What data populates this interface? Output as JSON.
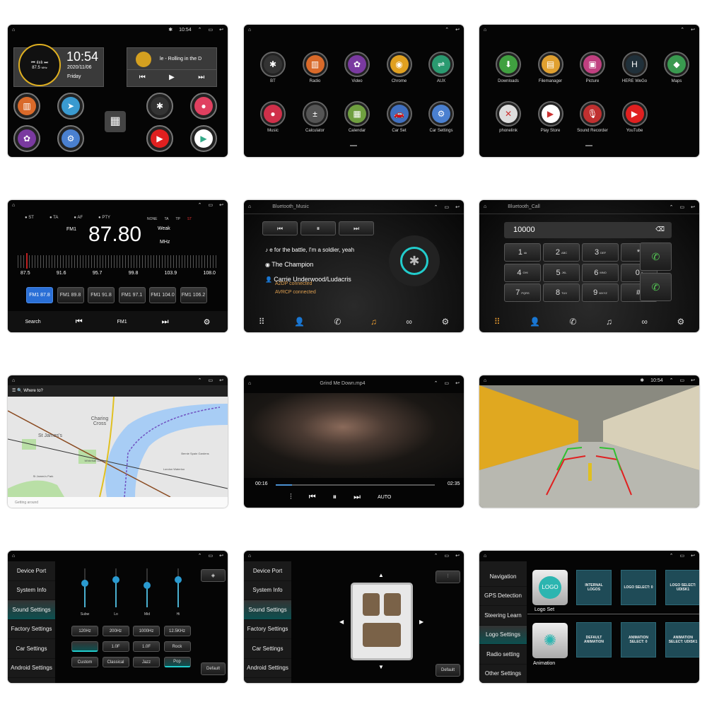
{
  "nav": {
    "home": "⌂",
    "up": "⌃",
    "recent": "▭",
    "back": "↩"
  },
  "home": {
    "time": "10:54",
    "clock": "10:54",
    "date": "2020/11/06",
    "day": "Friday",
    "radio_freq": "87.5",
    "radio_unit": "MHz",
    "song": "le - Rolling in the D"
  },
  "apps_page1": [
    {
      "label": "BT",
      "color": "#333",
      "glyph": "✱"
    },
    {
      "label": "Radio",
      "color": "#d96a2a",
      "glyph": "▥"
    },
    {
      "label": "Video",
      "color": "#7a3aa0",
      "glyph": "✿"
    },
    {
      "label": "Chrome",
      "color": "#e0a020",
      "glyph": "◉"
    },
    {
      "label": "AUX",
      "color": "#2a9a70",
      "glyph": "⇌"
    },
    {
      "label": "Music",
      "color": "#d0304a",
      "glyph": "●"
    },
    {
      "label": "Calculator",
      "color": "#555",
      "glyph": "±"
    },
    {
      "label": "Calendar",
      "color": "#70a040",
      "glyph": "▦"
    },
    {
      "label": "Car Set",
      "color": "#4070c0",
      "glyph": "🚗"
    },
    {
      "label": "Car Settings",
      "color": "#4a80d0",
      "glyph": "⚙"
    }
  ],
  "apps_page2": [
    {
      "label": "Downloads",
      "color": "#40a040",
      "glyph": "⬇"
    },
    {
      "label": "Filemanager",
      "color": "#e0a030",
      "glyph": "▤"
    },
    {
      "label": "Picture",
      "color": "#c04080",
      "glyph": "▣"
    },
    {
      "label": "HERE WeGo",
      "color": "#20303a",
      "glyph": "H"
    },
    {
      "label": "Maps",
      "color": "#3a9a50",
      "glyph": "◆"
    },
    {
      "label": "phonelink",
      "color": "#ddd",
      "glyph": "✕"
    },
    {
      "label": "Play Store",
      "color": "#fff",
      "glyph": "▶"
    },
    {
      "label": "Sound Recorder",
      "color": "#c03030",
      "glyph": "🎙"
    },
    {
      "label": "YouTube",
      "color": "#e02020",
      "glyph": "▶"
    }
  ],
  "radio": {
    "flags": [
      "ST",
      "TA",
      "AF",
      "PTY"
    ],
    "right_flags": [
      "NONE",
      "TA",
      "TP",
      "ST"
    ],
    "band": "FM1",
    "freq": "87.80",
    "signal": "Weak",
    "unit": "MHz",
    "scale": [
      "87.5",
      "91.6",
      "95.7",
      "99.8",
      "103.9",
      "108.0"
    ],
    "presets": [
      "FM1 87.8",
      "FM1 89.8",
      "FM1 91.8",
      "FM1 97.1",
      "FM1 104.0",
      "FM1 106.2"
    ],
    "active_preset": 0,
    "search": "Search",
    "band_btn": "FM1",
    "accent": "#2a6fd6"
  },
  "bt_music": {
    "title": "Bluetooth_Music",
    "lyric": "e for the battle, I'm a soldier, yeah",
    "song": "The Champion",
    "artist": "Carrie Underwood/Ludacris",
    "status1": "A2DP connected",
    "status2": "AVRCP connected"
  },
  "bt_call": {
    "title": "Bluetooth_Call",
    "number": "10000",
    "keys": [
      [
        "1",
        "ꝏ"
      ],
      [
        "2",
        "ABC"
      ],
      [
        "3",
        "DEF"
      ],
      [
        "*",
        ""
      ],
      [
        "4",
        "GHI"
      ],
      [
        "5",
        "JKL"
      ],
      [
        "6",
        "MNO"
      ],
      [
        "0",
        "+"
      ],
      [
        "7",
        "PQRS"
      ],
      [
        "8",
        "TUV"
      ],
      [
        "9",
        "WXYZ"
      ],
      [
        "#",
        ""
      ]
    ]
  },
  "map": {
    "search": "Where to?",
    "places": [
      "Charing Cross",
      "St James's",
      "London Waterloo",
      "Bernie Spain Gardens",
      "Whitehall Gardens",
      "St James's Park"
    ],
    "status": "Getting around"
  },
  "video": {
    "title": "Grind Me Down.mp4",
    "elapsed": "00:16",
    "total": "02:35",
    "mode": "AUTO",
    "progress": 0.1
  },
  "camera": {
    "time": "10:54"
  },
  "sound": {
    "menu": [
      "Device Port",
      "System Info",
      "Sound Settings",
      "Factory Settings",
      "Car Settings",
      "Android Settings"
    ],
    "active": 2,
    "bands": [
      "Subw",
      "Lo",
      "Mid",
      "Hi"
    ],
    "levels": [
      0.6,
      0.7,
      0.55,
      0.7
    ],
    "freqs": [
      "120Hz",
      "200Hz",
      "1000Hz",
      "12.5KHz"
    ],
    "row2": [
      "",
      "1.0F",
      "1.0F",
      "Rock"
    ],
    "presets": [
      "Custom",
      "Classical",
      "Jazz",
      "Pop"
    ],
    "active_preset": 3,
    "default": "Default"
  },
  "balance": {
    "default": "Default"
  },
  "logo": {
    "menu": [
      "Navigation",
      "GPS Detection",
      "Steering Learn",
      "Logo Settings",
      "Radio setting",
      "Other Settings"
    ],
    "active": 3,
    "logo_text": "LOGO",
    "logo_set": "Logo Set",
    "animation": "Animation",
    "tiles1": [
      "INTERNAL LOGOS",
      "LOGO SELECT: 0",
      "LOGO SELECT: UDISK1"
    ],
    "tiles2": [
      "DEFAULT ANIMATION",
      "ANIMATION SELECT: 0",
      "ANIMATION SELECT: UDISK1"
    ]
  }
}
